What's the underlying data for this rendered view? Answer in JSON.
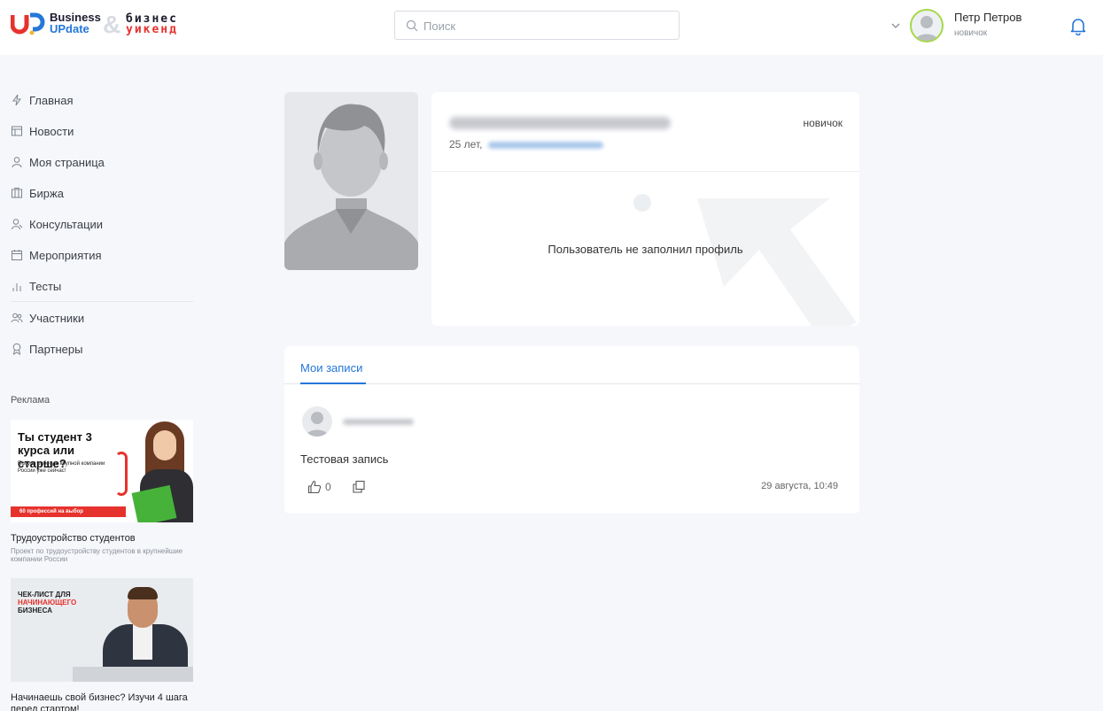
{
  "header": {
    "logo": {
      "line1": "Business",
      "line2": "UPdate",
      "amp": "&",
      "line3": "бизнес",
      "line4": "уикенд"
    },
    "search": {
      "placeholder": "Поиск",
      "value": ""
    },
    "user": {
      "name": "Петр Петров",
      "rank": "новичок"
    },
    "icons": [
      "search-icon",
      "chevron-down-icon",
      "bell-icon"
    ]
  },
  "sidebar": {
    "items": [
      {
        "label": "Главная",
        "icon": "lightning-icon"
      },
      {
        "label": "Новости",
        "icon": "news-icon"
      },
      {
        "label": "Моя страница",
        "icon": "user-icon"
      },
      {
        "label": "Биржа",
        "icon": "exchange-icon"
      },
      {
        "label": "Консультации",
        "icon": "consult-icon"
      },
      {
        "label": "Мероприятия",
        "icon": "calendar-icon"
      },
      {
        "label": "Тесты",
        "icon": "bars-icon"
      },
      {
        "label": "Участники",
        "icon": "users-icon"
      },
      {
        "label": "Партнеры",
        "icon": "award-icon"
      }
    ],
    "ads": {
      "title": "Реклама",
      "ad1": {
        "heading": "Ты студент 3 курса или старше?",
        "text": "Получи работу в крупной компании России уже сейчас!",
        "strip": "60 профессий на выбор",
        "caption": "Трудоустройство студентов",
        "description": "Проект по трудоустройству студентов в крупнейшие компании России"
      },
      "ad2": {
        "heading_1": "ЧЕК-ЛИСТ ДЛЯ",
        "heading_2": "НАЧИНАЮЩЕГО",
        "heading_3": "БИЗНЕСА",
        "caption": "Начинаешь свой бизнес? Изучи 4 шага перед стартом!"
      }
    }
  },
  "profile": {
    "age": "25 лет,",
    "rank": "новичок",
    "empty_message": "Пользователь не заполнил профиль"
  },
  "posts": {
    "tab": "Мои записи",
    "items": [
      {
        "text": "Тестовая запись",
        "likes": "0",
        "date": "29 августа, 10:49"
      }
    ]
  },
  "colors": {
    "accent": "#2477d9",
    "brand_red": "#e6322d",
    "avatar_ring": "#a6d84a"
  }
}
